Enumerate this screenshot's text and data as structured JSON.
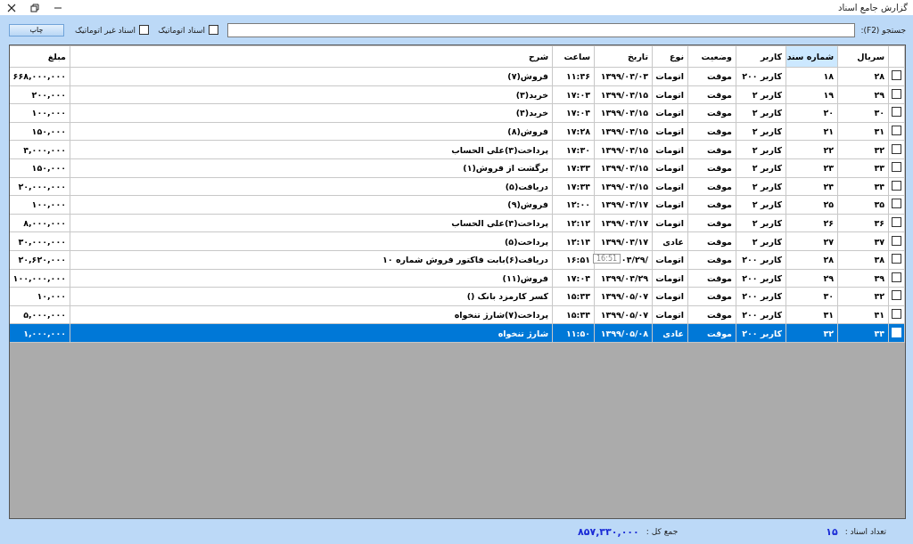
{
  "window": {
    "title": "گزارش جامع اسناد"
  },
  "toolbar": {
    "search_label": "جستجو (F2):",
    "filters": [
      {
        "label": "اسناد اتوماتیک",
        "checked": false
      },
      {
        "label": "اسناد غیر اتوماتیک",
        "checked": false
      }
    ],
    "print_button": "چاپ"
  },
  "table": {
    "columns": [
      {
        "label": "سریال",
        "selected": false
      },
      {
        "label": "شماره سند",
        "selected": true
      },
      {
        "label": "کاربر",
        "selected": false
      },
      {
        "label": "وضعیت",
        "selected": false
      },
      {
        "label": "نوع",
        "selected": false
      },
      {
        "label": "تاریخ",
        "selected": false
      },
      {
        "label": "ساعت",
        "selected": false
      },
      {
        "label": "شرح",
        "selected": false
      },
      {
        "label": "مبلغ",
        "selected": false
      }
    ],
    "rows": [
      {
        "checked": false,
        "selected": false,
        "cells": [
          "۲۸",
          "۱۸",
          "کاربر ۲۰۰",
          "موقت",
          "اتومات",
          "۱۳۹۹/۰۴/۰۳",
          "۱۱:۴۶",
          "فروش(۷)",
          "۶۶۸,۰۰۰,۰۰۰"
        ]
      },
      {
        "checked": false,
        "selected": false,
        "cells": [
          "۲۹",
          "۱۹",
          "کاربر ۲",
          "موقت",
          "اتومات",
          "۱۳۹۹/۰۴/۱۵",
          "۱۷:۰۳",
          "خرید(۳)",
          "۲۰۰,۰۰۰"
        ]
      },
      {
        "checked": false,
        "selected": false,
        "cells": [
          "۳۰",
          "۲۰",
          "کاربر ۲",
          "موقت",
          "اتومات",
          "۱۳۹۹/۰۴/۱۵",
          "۱۷:۰۴",
          "خرید(۴)",
          "۱۰۰,۰۰۰"
        ]
      },
      {
        "checked": false,
        "selected": false,
        "cells": [
          "۳۱",
          "۲۱",
          "کاربر ۲",
          "موقت",
          "اتومات",
          "۱۳۹۹/۰۴/۱۵",
          "۱۷:۲۸",
          "فروش(۸)",
          "۱۵۰,۰۰۰"
        ]
      },
      {
        "checked": false,
        "selected": false,
        "cells": [
          "۳۲",
          "۲۲",
          "کاربر ۲",
          "موقت",
          "اتومات",
          "۱۳۹۹/۰۴/۱۵",
          "۱۷:۳۰",
          "پرداخت(۳)علی الحساب",
          "۴,۰۰۰,۰۰۰"
        ]
      },
      {
        "checked": false,
        "selected": false,
        "cells": [
          "۳۳",
          "۲۳",
          "کاربر ۲",
          "موقت",
          "اتومات",
          "۱۳۹۹/۰۴/۱۵",
          "۱۷:۳۳",
          "برگشت از فروش(۱)",
          "۱۵۰,۰۰۰"
        ]
      },
      {
        "checked": false,
        "selected": false,
        "cells": [
          "۳۴",
          "۲۴",
          "کاربر ۲",
          "موقت",
          "اتومات",
          "۱۳۹۹/۰۴/۱۵",
          "۱۷:۳۴",
          "دریافت(۵)",
          "۲۰,۰۰۰,۰۰۰"
        ]
      },
      {
        "checked": false,
        "selected": false,
        "cells": [
          "۳۵",
          "۲۵",
          "کاربر ۲",
          "موقت",
          "اتومات",
          "۱۳۹۹/۰۴/۱۷",
          "۱۲:۰۰",
          "فروش(۹)",
          "۱۰۰,۰۰۰"
        ]
      },
      {
        "checked": false,
        "selected": false,
        "cells": [
          "۳۶",
          "۲۶",
          "کاربر ۲",
          "موقت",
          "اتومات",
          "۱۳۹۹/۰۴/۱۷",
          "۱۲:۱۲",
          "پرداخت(۴)علی الحساب",
          "۸,۰۰۰,۰۰۰"
        ]
      },
      {
        "checked": false,
        "selected": false,
        "cells": [
          "۳۷",
          "۲۷",
          "کاربر ۲",
          "موقت",
          "عادی",
          "۱۳۹۹/۰۴/۱۷",
          "۱۲:۱۴",
          "پرداخت(۵)",
          "۳۰,۰۰۰,۰۰۰"
        ]
      },
      {
        "checked": false,
        "selected": false,
        "cells": [
          "۳۸",
          "۲۸",
          "کاربر ۲۰۰",
          "موقت",
          "اتومات",
          "/۰۴/۲۹",
          "۱۶:۵۱",
          "دریافت(۶)بابت فاکتور فروش شماره ۱۰",
          "۲۰,۶۲۰,۰۰۰"
        ],
        "tooltip": "16:51"
      },
      {
        "checked": false,
        "selected": false,
        "cells": [
          "۳۹",
          "۲۹",
          "کاربر ۲۰۰",
          "موقت",
          "اتومات",
          "۱۳۹۹/۰۴/۲۹",
          "۱۷:۰۴",
          "فروش(۱۱)",
          "۱۰۰,۰۰۰,۰۰۰"
        ]
      },
      {
        "checked": false,
        "selected": false,
        "cells": [
          "۴۲",
          "۳۰",
          "کاربر ۲۰۰",
          "موقت",
          "اتومات",
          "۱۳۹۹/۰۵/۰۷",
          "۱۵:۴۳",
          "کسر کارمزد بانک ()",
          "۱۰,۰۰۰"
        ]
      },
      {
        "checked": false,
        "selected": false,
        "cells": [
          "۴۱",
          "۳۱",
          "کاربر ۲۰۰",
          "موقت",
          "اتومات",
          "۱۳۹۹/۰۵/۰۷",
          "۱۵:۴۴",
          "پرداخت(۷)شارژ تنخواه",
          "۵,۰۰۰,۰۰۰"
        ]
      },
      {
        "checked": false,
        "selected": true,
        "cells": [
          "۴۴",
          "۳۲",
          "کاربر ۲۰۰",
          "موقت",
          "عادی",
          "۱۳۹۹/۰۵/۰۸",
          "۱۱:۵۰",
          "شارژ تنخواه",
          "۱,۰۰۰,۰۰۰"
        ]
      }
    ]
  },
  "status_bar": {
    "count_label": "تعداد اسناد :",
    "count": "۱۵",
    "total_label": "جمع کل :",
    "total": "۸۵۷,۳۳۰,۰۰۰"
  }
}
